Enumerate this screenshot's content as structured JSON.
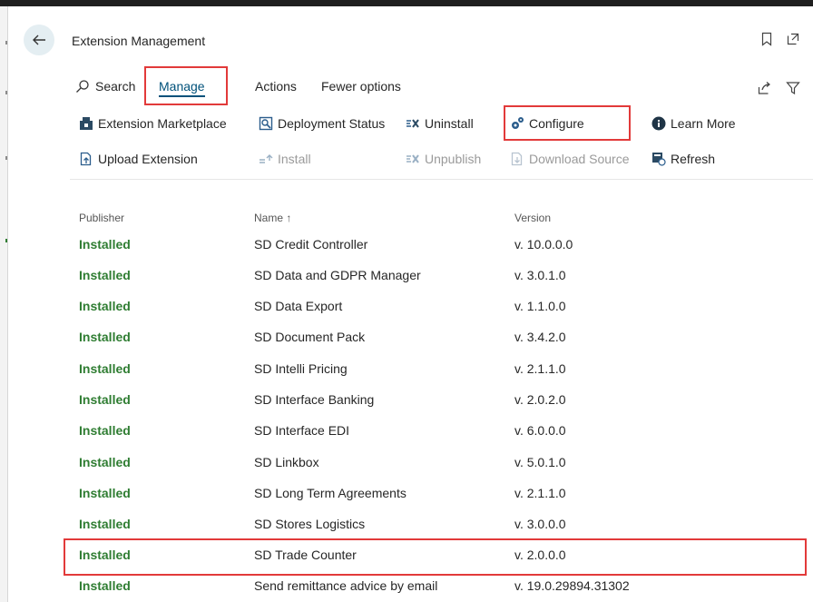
{
  "header": {
    "title": "Extension Management"
  },
  "tabs": {
    "search": "Search",
    "manage": "Manage",
    "actions": "Actions",
    "fewer": "Fewer options"
  },
  "actions_row1": {
    "marketplace": "Extension Marketplace",
    "deployment": "Deployment Status",
    "uninstall": "Uninstall",
    "configure": "Configure",
    "learn": "Learn More"
  },
  "actions_row2": {
    "upload": "Upload Extension",
    "install": "Install",
    "unpublish": "Unpublish",
    "download": "Download Source",
    "refresh": "Refresh"
  },
  "columns": {
    "publisher": "Publisher",
    "name": "Name ↑",
    "version": "Version"
  },
  "rows": [
    {
      "publisher": "Installed",
      "name": "SD Credit Controller",
      "version": "v. 10.0.0.0"
    },
    {
      "publisher": "Installed",
      "name": "SD Data and GDPR Manager",
      "version": "v. 3.0.1.0"
    },
    {
      "publisher": "Installed",
      "name": "SD Data Export",
      "version": "v. 1.1.0.0"
    },
    {
      "publisher": "Installed",
      "name": "SD Document Pack",
      "version": "v. 3.4.2.0"
    },
    {
      "publisher": "Installed",
      "name": "SD Intelli Pricing",
      "version": "v. 2.1.1.0"
    },
    {
      "publisher": "Installed",
      "name": "SD Interface Banking",
      "version": "v. 2.0.2.0"
    },
    {
      "publisher": "Installed",
      "name": "SD Interface EDI",
      "version": "v. 6.0.0.0"
    },
    {
      "publisher": "Installed",
      "name": "SD Linkbox",
      "version": "v. 5.0.1.0"
    },
    {
      "publisher": "Installed",
      "name": "SD Long Term Agreements",
      "version": "v. 2.1.1.0"
    },
    {
      "publisher": "Installed",
      "name": "SD Stores Logistics",
      "version": "v. 3.0.0.0"
    },
    {
      "publisher": "Installed",
      "name": "SD Trade Counter",
      "version": "v. 2.0.0.0"
    },
    {
      "publisher": "Installed",
      "name": "Send remittance advice by email",
      "version": "v. 19.0.29894.31302"
    }
  ],
  "colors": {
    "installed_green": "#2f7d32",
    "accent": "#00517a",
    "highlight": "#e23a3a"
  },
  "icons": {
    "back": "arrow-left-icon",
    "bookmark": "bookmark-icon",
    "popout": "open-new-window-icon",
    "share": "share-icon",
    "filter": "filter-icon",
    "search": "search-icon"
  }
}
